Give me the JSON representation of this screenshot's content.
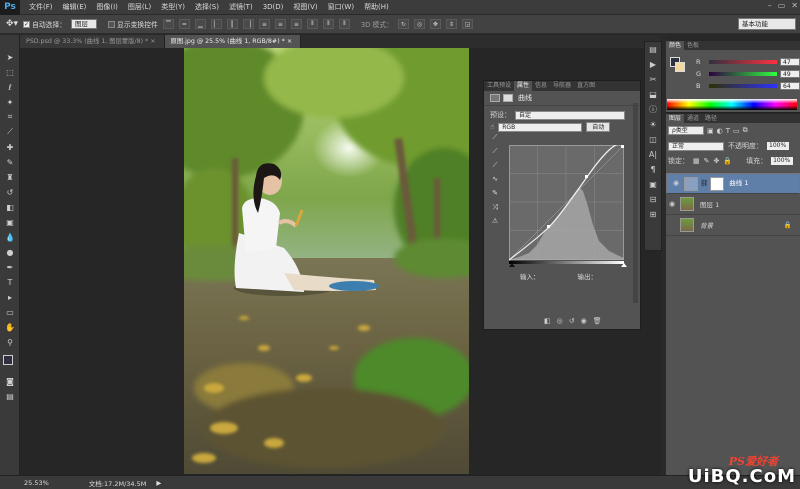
{
  "app": {
    "logo": "Ps"
  },
  "menu": [
    "文件(F)",
    "编辑(E)",
    "图像(I)",
    "图层(L)",
    "类型(Y)",
    "选择(S)",
    "滤镜(T)",
    "3D(D)",
    "视图(V)",
    "窗口(W)",
    "帮助(H)"
  ],
  "window_controls": [
    "–",
    "▭",
    "✕"
  ],
  "options": {
    "auto_select_label": "自动选择：",
    "auto_select_value": "图层",
    "show_transform_label": "显示变换控件",
    "mode_3d_label": "3D 模式：",
    "workspace": "基本功能"
  },
  "tabs": [
    {
      "label": "PSD.psd @ 33.3% (曲线 1, 图层蒙版/8) *",
      "close": "×",
      "active": false
    },
    {
      "label": "原图.jpg @ 25.5% (曲线 1, RGB/8#) *",
      "close": "×",
      "active": true
    }
  ],
  "properties": {
    "tabs": [
      "工具预设",
      "属性",
      "信息",
      "导航器",
      "直方图"
    ],
    "active_tab": "属性",
    "title": "曲线",
    "preset_label": "预设：",
    "preset_value": "自定",
    "channel_value": "RGB",
    "auto_label": "自动",
    "input_label": "输入：",
    "output_label": "输出："
  },
  "color_panel": {
    "tabs": [
      "颜色",
      "色板"
    ],
    "channels": [
      {
        "label": "R",
        "value": "47"
      },
      {
        "label": "G",
        "value": "49"
      },
      {
        "label": "B",
        "value": "64"
      }
    ],
    "fg_color": "#2f3140"
  },
  "layers_panel": {
    "tabs": [
      "图层",
      "通道",
      "路径"
    ],
    "kind_filter": "ρ类型",
    "blend_mode": "正常",
    "opacity_label": "不透明度：",
    "opacity_value": "100%",
    "lock_label": "锁定：",
    "fill_label": "填充：",
    "fill_value": "100%",
    "layers": [
      {
        "name": "曲线 1",
        "selected": true
      },
      {
        "name": "图层 1",
        "selected": false
      },
      {
        "name": "背景",
        "selected": false
      }
    ]
  },
  "status": {
    "zoom": "25.53%",
    "doc": "文档:17.2M/34.5M"
  },
  "watermark": {
    "text": "UiBQ.CoM",
    "ps_text": "PS爱好者"
  }
}
